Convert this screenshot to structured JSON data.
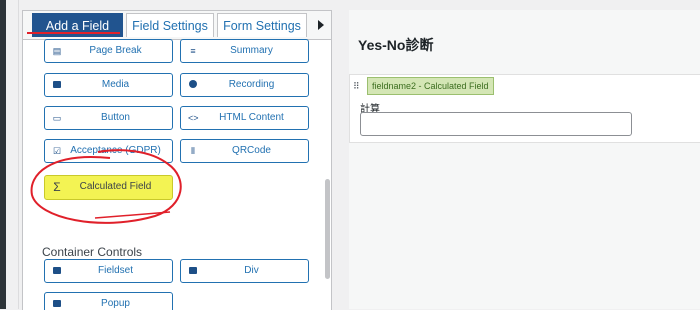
{
  "tabs": [
    {
      "label": "Add a Field",
      "active": true
    },
    {
      "label": "Field Settings",
      "active": false
    },
    {
      "label": "Form Settings",
      "active": false
    }
  ],
  "fields_top": [
    {
      "label": "Page Break",
      "icon": "page-break-icon"
    },
    {
      "label": "Summary",
      "icon": "summary-icon"
    },
    {
      "label": "Media",
      "icon": "media-icon"
    },
    {
      "label": "Recording",
      "icon": "recording-icon"
    },
    {
      "label": "Button",
      "icon": "button-icon"
    },
    {
      "label": "HTML Content",
      "icon": "code-icon"
    },
    {
      "label": "Acceptance (GDPR)",
      "icon": "checkbox-icon"
    },
    {
      "label": "QRCode",
      "icon": "qrcode-icon"
    },
    {
      "label": "Calculated Field",
      "icon": "sigma-icon",
      "highlighted": true
    }
  ],
  "container_section_title": "Container Controls",
  "container_fields": [
    {
      "label": "Fieldset",
      "icon": "fieldset-icon"
    },
    {
      "label": "Div",
      "icon": "div-icon"
    },
    {
      "label": "Popup",
      "icon": "popup-icon"
    }
  ],
  "preview": {
    "form_title": "Yes-No診断",
    "field_tag": "fieldname2 - Calculated Field",
    "field_label": "計算",
    "field_value": ""
  },
  "colors": {
    "active_tab": "#21548f",
    "accent": "#2271b1",
    "highlight": "#f3f353",
    "annotation": "#e0202a"
  }
}
